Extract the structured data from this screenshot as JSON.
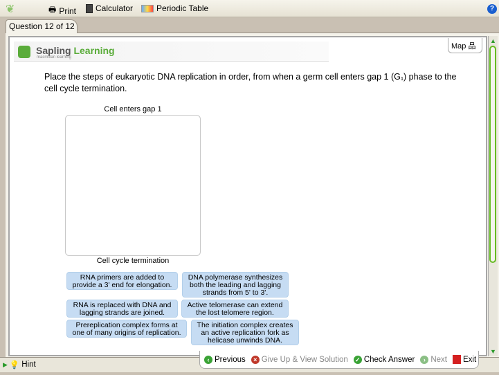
{
  "toolbar": {
    "print": "Print",
    "calculator": "Calculator",
    "periodic_table": "Periodic Table"
  },
  "tab": {
    "label": "Question 12 of 12"
  },
  "logo": {
    "brand1": "Sapling",
    "brand2": "Learning",
    "sub": "macmillan learning"
  },
  "map": {
    "label": "Map"
  },
  "question": {
    "text": "Place the steps of eukaryotic DNA replication in order, from when a germ cell enters gap 1 (G₁) phase to the cell cycle termination."
  },
  "dropzone": {
    "top_label": "Cell enters gap 1",
    "bottom_label": "Cell cycle termination"
  },
  "cards": [
    "RNA primers are added to provide a 3' end for elongation.",
    "DNA polymerase synthesizes both the leading and lagging strands from 5' to 3'.",
    "RNA is replaced with DNA and lagging strands are joined.",
    "Active telomerase can extend the lost telomere region.",
    "Prereplication complex forms at one of many origins of replication.",
    "The initiation complex creates an active replication fork as helicase unwinds DNA."
  ],
  "nav": {
    "previous": "Previous",
    "give_up": "Give Up & View Solution",
    "check": "Check Answer",
    "next": "Next",
    "exit": "Exit"
  },
  "hint": {
    "label": "Hint"
  },
  "colors": {
    "brand_green": "#5aac3a",
    "card_blue": "#c6dcf3"
  }
}
